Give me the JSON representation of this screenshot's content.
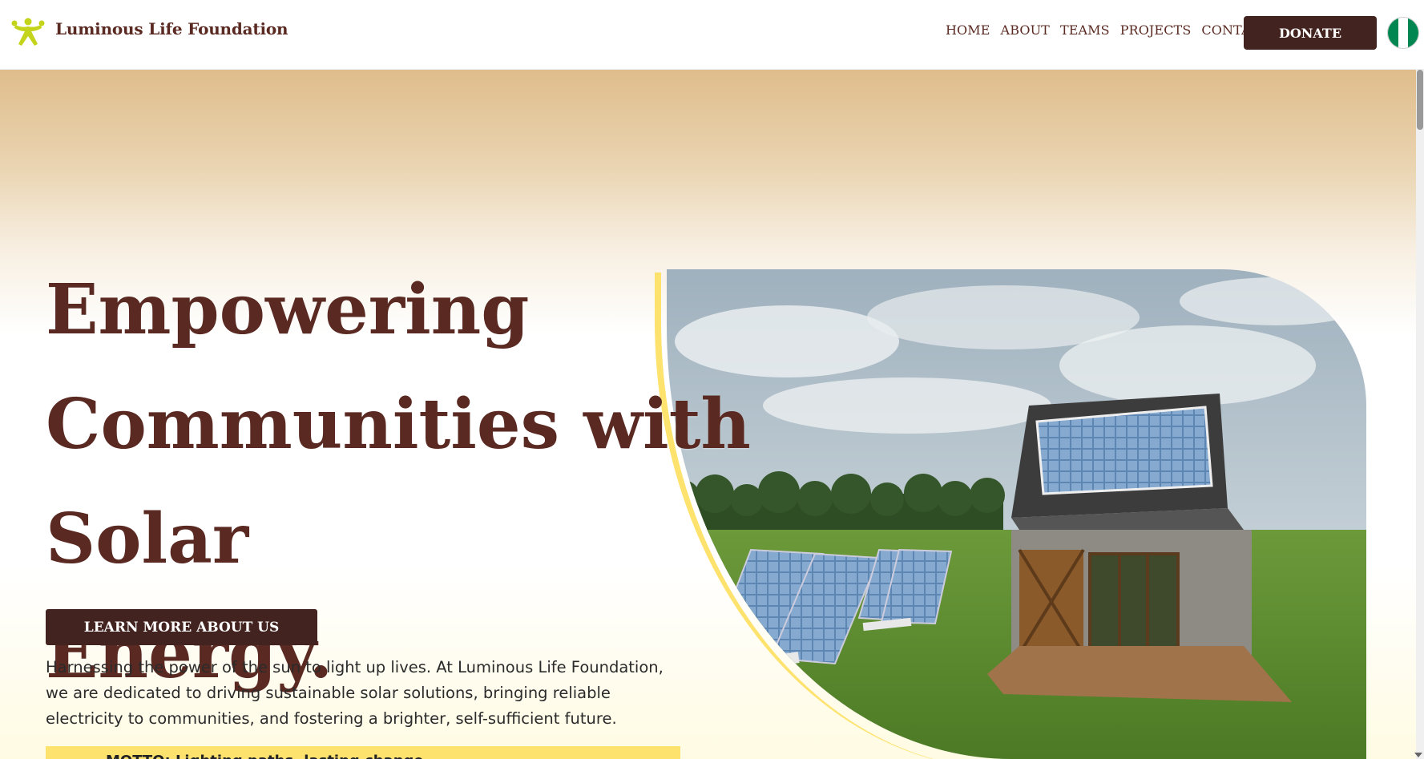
{
  "header": {
    "brand": "Luminous Life Foundation",
    "logo_icon": "sun-figure-icon",
    "nav": [
      "HOME",
      "ABOUT",
      "TEAMS",
      "PROJECTS",
      "CONTACT"
    ],
    "donate_label": "DONATE",
    "flag_icon": "nigeria-flag-icon"
  },
  "hero": {
    "heading_line1": "Empowering",
    "heading_line2": "Communities with Solar",
    "heading_line3": "Energy.",
    "cta_label": "LEARN MORE ABOUT US",
    "description": "Harnessing the power of the sun to light up lives. At Luminous Life Foundation, we are dedicated to driving sustainable solar solutions, bringing reliable electricity to communities, and fostering a brighter, self-sufficient future.",
    "motto": "MOTTO: Lighting paths, lasting change"
  },
  "colors": {
    "primary": "#432320",
    "text_brown": "#5a2a22",
    "accent_yellow": "#fde36e",
    "logo_green": "#b8cf1c",
    "flag_green": "#008751"
  }
}
